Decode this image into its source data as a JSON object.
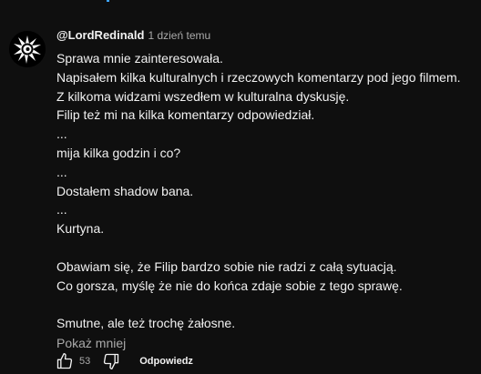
{
  "comment": {
    "author": "@LordRedinald",
    "timestamp": "1 dzień temu",
    "lines": [
      "Sprawa mnie zainteresowała.",
      "Napisałem kilka kulturalnych i rzeczowych komentarzy pod jego filmem.",
      "Z kilkoma widzami wszedłem w kulturalna dyskusję.",
      "Filip też mi na kilka komentarzy odpowiedział.",
      "...",
      "mija kilka godzin i co?",
      "...",
      "Dostałem shadow bana.",
      "...",
      "Kurtyna.",
      "",
      "Obawiam się, że Filip bardzo sobie nie radzi z całą sytuacją.",
      "Co gorsza, myślę że nie do końca zdaje sobie z tego sprawę.",
      "",
      "Smutne, ale też trochę żałosne."
    ],
    "show_less": "Pokaż mniej",
    "like_count": "53",
    "reply_label": "Odpowiedz",
    "like_icon": "thumb-up-icon",
    "dislike_icon": "thumb-down-icon"
  },
  "colors": {
    "background": "#0f0f0f",
    "text_primary": "#f1f1f1",
    "text_secondary": "#aaaaaa",
    "accent": "#3ea6ff"
  }
}
